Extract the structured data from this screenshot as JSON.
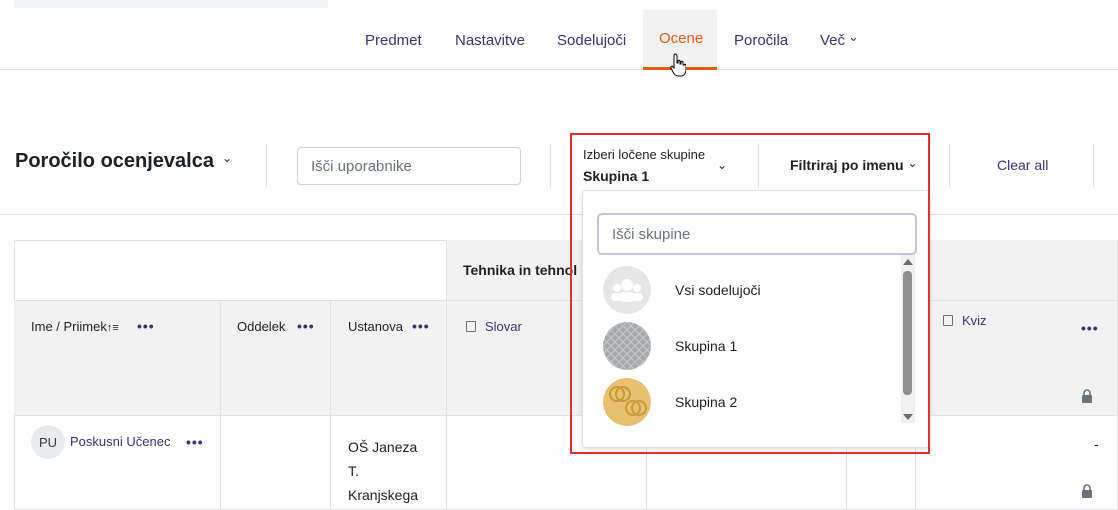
{
  "nav": {
    "items": [
      {
        "label": "Predmet"
      },
      {
        "label": "Nastavitve"
      },
      {
        "label": "Sodelujoči"
      },
      {
        "label": "Ocene"
      },
      {
        "label": "Poročila"
      },
      {
        "label": "Več"
      }
    ],
    "active": "Ocene",
    "more_chevron": "⌄"
  },
  "header": {
    "title": "Poročilo ocenjevalca",
    "title_chevron": "⌄",
    "search_placeholder": "Išči uporabnike",
    "group_label": "Izberi ločene skupine",
    "group_value": "Skupina 1",
    "group_chevron": "⌄",
    "filter_label": "Filtriraj po imenu",
    "filter_chevron": "⌄",
    "clear_all": "Clear all"
  },
  "table": {
    "category_title": "Tehnika in tehnol",
    "columns": {
      "name": "Ime / Priimek",
      "sort_icon": "↑≡",
      "department": "Oddelek",
      "institution": "Ustanova",
      "item1": "Slovar",
      "item2": "Kviz"
    },
    "menu_dots": "•••",
    "rows": [
      {
        "initials": "PU",
        "name": "Poskusni Učenec",
        "institution_lines": [
          "OŠ Janeza",
          "T.",
          "Kranjskega"
        ],
        "kviz_value": "-"
      }
    ]
  },
  "group_dropdown": {
    "search_placeholder": "Išči skupine",
    "groups": [
      {
        "name": "Vsi sodelujoči",
        "icon": "people-icon"
      },
      {
        "name": "Skupina 1",
        "icon": "group-picture-gray"
      },
      {
        "name": "Skupina 2",
        "icon": "group-picture-gold"
      }
    ]
  },
  "colors": {
    "accent": "#e8590c",
    "link": "#3a3477",
    "highlight": "#e03030"
  }
}
